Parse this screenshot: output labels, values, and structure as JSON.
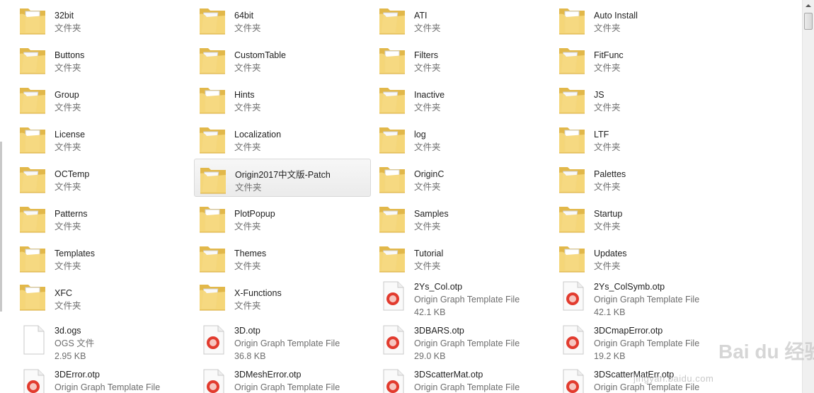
{
  "folders": [
    {
      "name": "32bit",
      "type": "文件夹",
      "icon": "folder-icon"
    },
    {
      "name": "64bit",
      "type": "文件夹",
      "icon": "folder-icon"
    },
    {
      "name": "ATI",
      "type": "文件夹",
      "icon": "folder-icon"
    },
    {
      "name": "Auto Install",
      "type": "文件夹",
      "icon": "folder-icon"
    },
    {
      "name": "Buttons",
      "type": "文件夹",
      "icon": "folder-icon"
    },
    {
      "name": "CustomTable",
      "type": "文件夹",
      "icon": "folder-icon"
    },
    {
      "name": "Filters",
      "type": "文件夹",
      "icon": "folder-icon"
    },
    {
      "name": "FitFunc",
      "type": "文件夹",
      "icon": "folder-icon"
    },
    {
      "name": "Group",
      "type": "文件夹",
      "icon": "folder-icon"
    },
    {
      "name": "Hints",
      "type": "文件夹",
      "icon": "folder-icon"
    },
    {
      "name": "Inactive",
      "type": "文件夹",
      "icon": "folder-icon"
    },
    {
      "name": "JS",
      "type": "文件夹",
      "icon": "folder-icon"
    },
    {
      "name": "License",
      "type": "文件夹",
      "icon": "folder-icon"
    },
    {
      "name": "Localization",
      "type": "文件夹",
      "icon": "folder-icon"
    },
    {
      "name": "log",
      "type": "文件夹",
      "icon": "folder-icon"
    },
    {
      "name": "LTF",
      "type": "文件夹",
      "icon": "folder-icon"
    },
    {
      "name": "OCTemp",
      "type": "文件夹",
      "icon": "folder-icon"
    },
    {
      "name": "Origin2017中文版-Patch",
      "type": "文件夹",
      "icon": "folder-icon",
      "selected": true
    },
    {
      "name": "OriginC",
      "type": "文件夹",
      "icon": "folder-icon"
    },
    {
      "name": "Palettes",
      "type": "文件夹",
      "icon": "folder-icon"
    },
    {
      "name": "Patterns",
      "type": "文件夹",
      "icon": "folder-icon"
    },
    {
      "name": "PlotPopup",
      "type": "文件夹",
      "icon": "folder-icon"
    },
    {
      "name": "Samples",
      "type": "文件夹",
      "icon": "folder-icon"
    },
    {
      "name": "Startup",
      "type": "文件夹",
      "icon": "folder-icon"
    },
    {
      "name": "Templates",
      "type": "文件夹",
      "icon": "folder-icon"
    },
    {
      "name": "Themes",
      "type": "文件夹",
      "icon": "folder-icon"
    },
    {
      "name": "Tutorial",
      "type": "文件夹",
      "icon": "folder-icon"
    },
    {
      "name": "Updates",
      "type": "文件夹",
      "icon": "folder-icon"
    }
  ],
  "files": [
    {
      "name": "XFC",
      "type": "文件夹",
      "size": "",
      "icon": "folder-icon"
    },
    {
      "name": "X-Functions",
      "type": "文件夹",
      "size": "",
      "icon": "folder-icon"
    },
    {
      "name": "2Ys_Col.otp",
      "type": "Origin Graph Template File",
      "size": "42.1 KB",
      "icon": "otp-file-icon"
    },
    {
      "name": "2Ys_ColSymb.otp",
      "type": "Origin Graph Template File",
      "size": "42.1 KB",
      "icon": "otp-file-icon"
    },
    {
      "name": "3d.ogs",
      "type": "OGS 文件",
      "size": "2.95 KB",
      "icon": "blank-file-icon"
    },
    {
      "name": "3D.otp",
      "type": "Origin Graph Template File",
      "size": "36.8 KB",
      "icon": "otp-file-icon"
    },
    {
      "name": "3DBARS.otp",
      "type": "Origin Graph Template File",
      "size": "29.0 KB",
      "icon": "otp-file-icon"
    },
    {
      "name": "3DCmapError.otp",
      "type": "Origin Graph Template File",
      "size": "19.2 KB",
      "icon": "otp-file-icon"
    },
    {
      "name": "3DError.otp",
      "type": "Origin Graph Template File",
      "size": "",
      "icon": "otp-file-icon"
    },
    {
      "name": "3DMeshError.otp",
      "type": "Origin Graph Template File",
      "size": "",
      "icon": "otp-file-icon"
    },
    {
      "name": "3DScatterMat.otp",
      "type": "Origin Graph Template File",
      "size": "",
      "icon": "otp-file-icon"
    },
    {
      "name": "3DScatterMatErr.otp",
      "type": "Origin Graph Template File",
      "size": "",
      "icon": "otp-file-icon"
    }
  ],
  "watermark": {
    "brand": "Bai du 经验",
    "url": "jingyan.baidu.com"
  },
  "colors": {
    "folder": "#f5d77a",
    "folder_dark": "#e2b84a",
    "otp_red": "#e23b2e",
    "selection": "#ebebeb"
  }
}
